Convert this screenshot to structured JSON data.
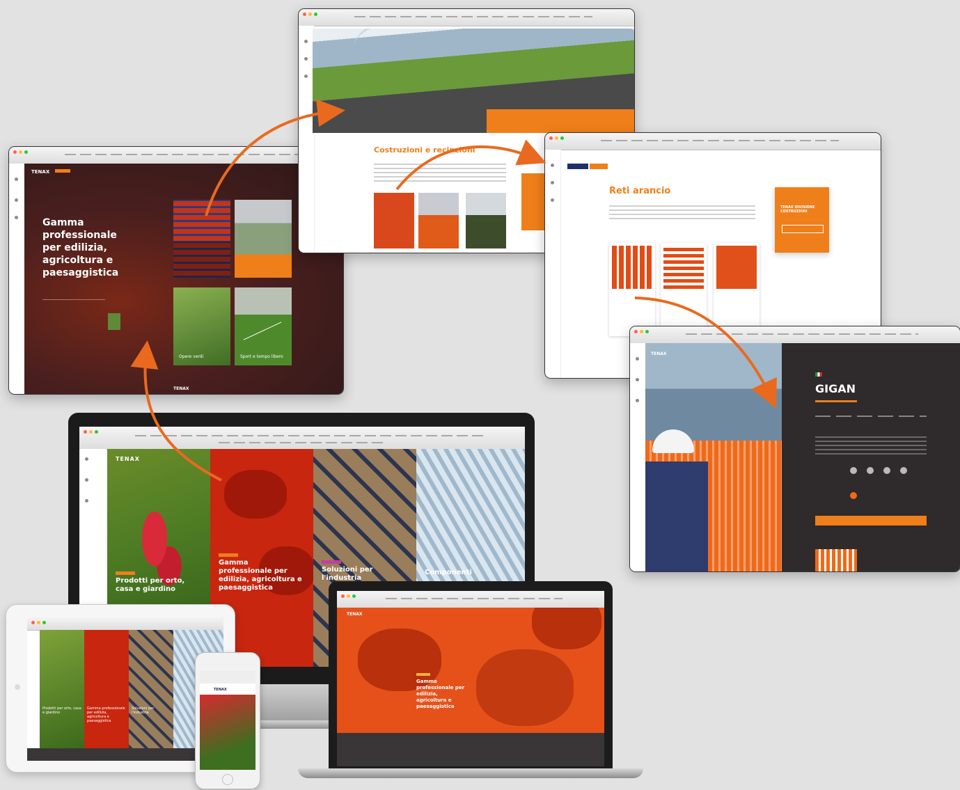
{
  "colors": {
    "background": "#e3e2e2",
    "brand_orange": "#ef7f1a",
    "dark_panel": "#2f2a2c",
    "maroon": "#4a1f1e"
  },
  "win_home": {
    "brand": "TENAX",
    "headline": "Gamma professionale per edilizia, agricoltura e paesaggistica",
    "tiles": [
      "Opere verdi",
      "Sport e tempo libero"
    ],
    "footer_brand": "TENAX"
  },
  "win_construction": {
    "title": "Costruzioni e recinzioni"
  },
  "win_reti": {
    "title": "Reti arancio",
    "cta": "TENAX DIVISIONE COSTRUZIONI"
  },
  "win_gigan": {
    "brand": "TENAX",
    "title": "GIGAN"
  },
  "desktop": {
    "brand": "TENAX",
    "panels": [
      "Prodotti per orto, casa e giardino",
      "Gamma professionale per edilizia, agricoltura e paesaggistica",
      "Soluzioni per l'industria",
      "Componenti"
    ]
  },
  "tablet": {
    "panels": [
      "Prodotti per orto, casa e giardino",
      "Gamma professionale per edilizia, agricoltura e paesaggistica",
      "Soluzioni per l'industria"
    ]
  },
  "laptop": {
    "brand": "TENAX",
    "headline": "Gamma professionale per edilizia, agricoltura e paesaggistica"
  },
  "phone": {
    "brand": "TENAX"
  }
}
